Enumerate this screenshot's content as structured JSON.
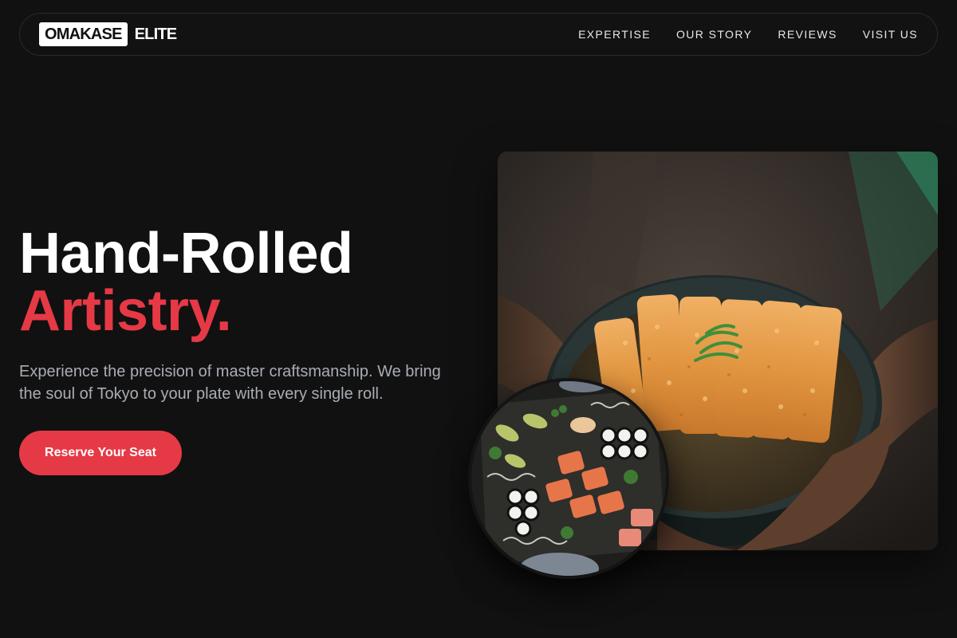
{
  "brand": {
    "logo_box_text": "OMAKASE",
    "logo_text": "ELITE"
  },
  "nav": {
    "links": [
      "EXPERTISE",
      "OUR STORY",
      "REVIEWS",
      "VISIT US"
    ]
  },
  "hero": {
    "title_line1": "Hand-Rolled",
    "title_line2": "Artistry.",
    "subtitle": "Experience the precision of master craftsmanship. We bring the soul of Tokyo to your plate with every single roll.",
    "cta_label": "Reserve Your Seat"
  },
  "colors": {
    "background": "#111111",
    "accent": "#e63946",
    "subtitle_text": "#a9adb4"
  },
  "images": {
    "main": "bowl-of-katsu-photo",
    "round": "sushi-platter-photo"
  }
}
